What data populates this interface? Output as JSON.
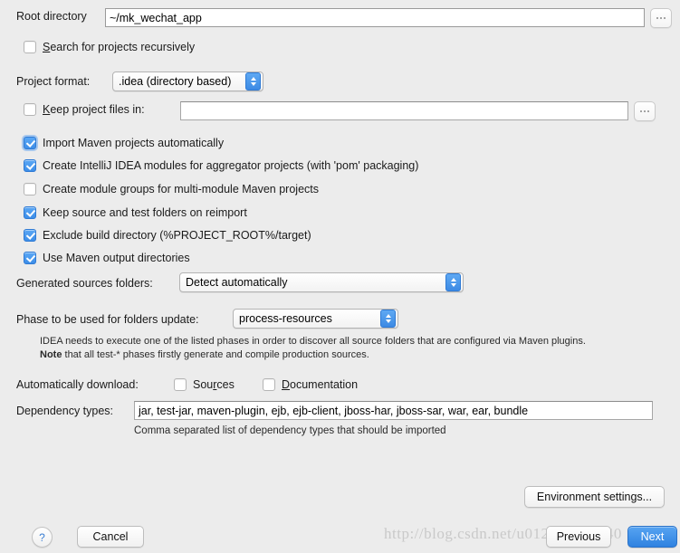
{
  "root_directory": {
    "label": "Root directory",
    "value": "~/mk_wechat_app",
    "browse_label": "..."
  },
  "search_recursively": {
    "label": "Search for projects recursively",
    "checked": false
  },
  "project_format": {
    "label": "Project format:",
    "value": ".idea (directory based)"
  },
  "keep_project_files": {
    "label": "Keep project files in:",
    "checked": false,
    "value": "",
    "browse_label": "..."
  },
  "options": [
    {
      "label": "Import Maven projects automatically",
      "checked": true,
      "focused": true
    },
    {
      "label": "Create IntelliJ IDEA modules for aggregator projects (with 'pom' packaging)",
      "checked": true,
      "focused": false
    },
    {
      "label": "Create module groups for multi-module Maven projects",
      "checked": false,
      "focused": false
    },
    {
      "label": "Keep source and test folders on reimport",
      "checked": true,
      "focused": false
    },
    {
      "label": "Exclude build directory (%PROJECT_ROOT%/target)",
      "checked": true,
      "focused": false
    },
    {
      "label": "Use Maven output directories",
      "checked": true,
      "focused": false
    }
  ],
  "generated_sources": {
    "label": "Generated sources folders:",
    "value": "Detect automatically"
  },
  "phase_update": {
    "label": "Phase to be used for folders update:",
    "value": "process-resources",
    "note_line1": "IDEA needs to execute one of the listed phases in order to discover all source folders that are configured via Maven plugins.",
    "note_line2_bold": "Note",
    "note_line2_rest": " that all test-* phases firstly generate and compile production sources."
  },
  "auto_download": {
    "label": "Automatically download:",
    "sources": {
      "label": "Sources",
      "checked": false
    },
    "documentation": {
      "label": "Documentation",
      "checked": false
    }
  },
  "dependency_types": {
    "label": "Dependency types:",
    "value": "jar, test-jar, maven-plugin, ejb, ejb-client, jboss-har, jboss-sar, war, ear, bundle",
    "hint": "Comma separated list of dependency types that should be imported"
  },
  "buttons": {
    "environment_settings": "Environment settings...",
    "help": "?",
    "cancel": "Cancel",
    "previous": "Previous",
    "next": "Next"
  },
  "watermark": "http://blog.csdn.net/u012854113740",
  "colors": {
    "background": "#ececec",
    "accent_blue": "#3d8ee8",
    "primary_button": "#2f82e0",
    "field_border": "#a6a6a6",
    "watermark": "#c9c9c9"
  }
}
